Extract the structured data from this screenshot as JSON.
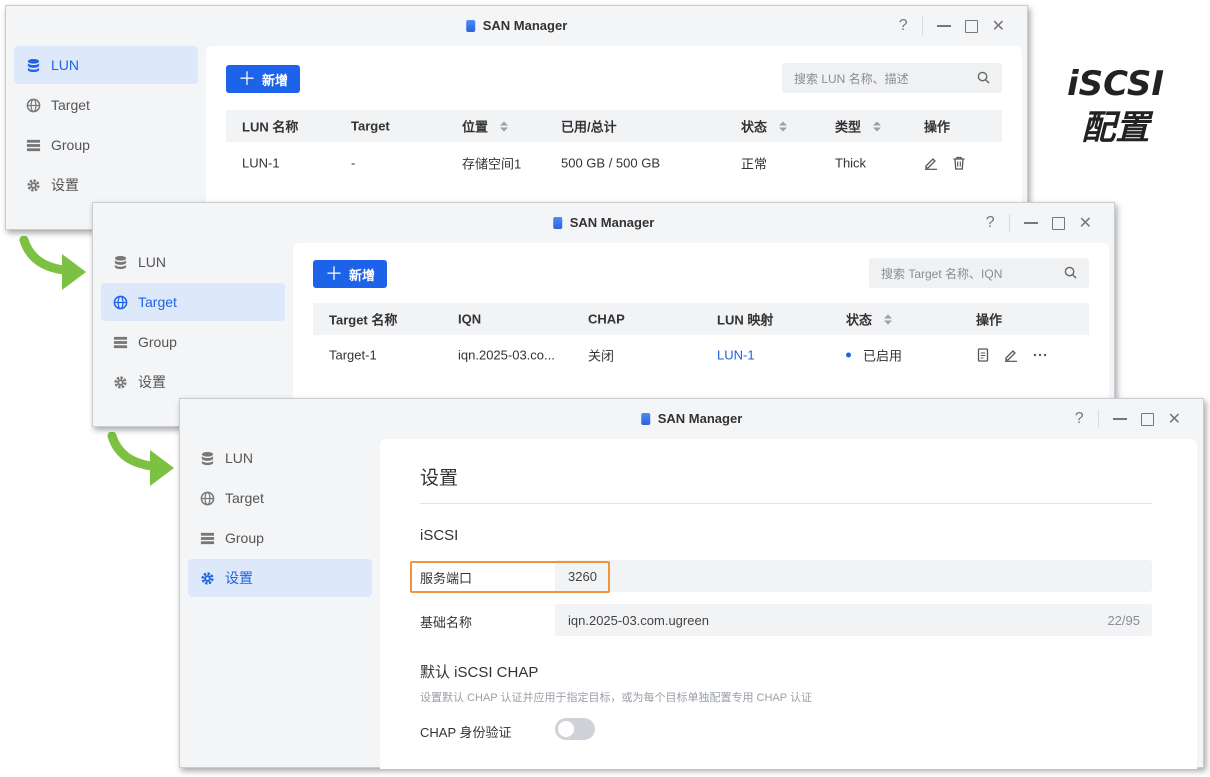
{
  "app_title": "SAN Manager",
  "window_controls": {
    "help": "?",
    "close": "✕"
  },
  "side_label": {
    "line1": "iSCSI",
    "line2": "配置"
  },
  "nav": {
    "lun": "LUN",
    "target": "Target",
    "group": "Group",
    "settings": "设置"
  },
  "lun_page": {
    "new_button": "新增",
    "search_placeholder": "搜索 LUN 名称、描述",
    "columns": [
      "LUN 名称",
      "Target",
      "位置",
      "已用/总计",
      "状态",
      "类型",
      "操作"
    ],
    "rows": [
      {
        "name": "LUN-1",
        "target": "-",
        "location": "存储空间1",
        "usage": "500 GB / 500 GB",
        "status": "正常",
        "type": "Thick"
      }
    ]
  },
  "target_page": {
    "new_button": "新增",
    "search_placeholder": "搜索 Target 名称、IQN",
    "columns": [
      "Target 名称",
      "IQN",
      "CHAP",
      "LUN 映射",
      "状态",
      "操作"
    ],
    "rows": [
      {
        "name": "Target-1",
        "iqn": "iqn.2025-03.co...",
        "chap": "关闭",
        "lun_mapping": "LUN-1",
        "status": "已启用"
      }
    ]
  },
  "settings_page": {
    "title": "设置",
    "section_iscsi": "iSCSI",
    "port_label": "服务端口",
    "port_value": "3260",
    "base_name_label": "基础名称",
    "base_name_value": "iqn.2025-03.com.ugreen",
    "base_name_count": "22/95",
    "chap_section": "默认 iSCSI CHAP",
    "chap_hint": "设置默认 CHAP 认证并应用于指定目标，或为每个目标单独配置专用 CHAP 认证",
    "chap_auth_label": "CHAP 身份验证",
    "chap_auth_enabled": false
  },
  "colors": {
    "accent": "#1d63ea",
    "highlight": "#f0953a",
    "arrow": "#7cc142"
  }
}
